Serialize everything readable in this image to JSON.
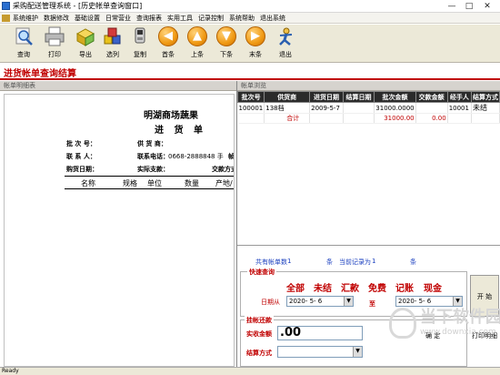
{
  "window": {
    "title": "采购配送管理系统 - [历史帐单查询窗口]",
    "minimize": "—",
    "maximize": "□",
    "close": "✕"
  },
  "menu": [
    "系统维护",
    "数据修改",
    "基础设置",
    "日常营业",
    "查询报表",
    "实用工具",
    "记录控制",
    "系统帮助",
    "退出系统"
  ],
  "toolbar": [
    {
      "label": "查询",
      "icon": "magnifier-icon"
    },
    {
      "label": "打印",
      "icon": "printer-icon"
    },
    {
      "label": "导出",
      "icon": "export-icon"
    },
    {
      "label": "选列",
      "icon": "columns-icon"
    },
    {
      "label": "复制",
      "icon": "copy-icon"
    },
    {
      "label": "首条",
      "icon": "first-record-icon"
    },
    {
      "label": "上条",
      "icon": "previous-record-icon"
    },
    {
      "label": "下条",
      "icon": "next-record-icon"
    },
    {
      "label": "末条",
      "icon": "last-record-icon"
    },
    {
      "label": "退出",
      "icon": "exit-icon"
    }
  ],
  "report_title": "进货帐单查询结算",
  "left_panel": {
    "header": "帐单明细表",
    "doc": {
      "store": "明湖商场蔬果",
      "subtitle": "进 货 单",
      "batch_label": "批 次 号：",
      "supplier_label": "供 货 商：",
      "contact_label": "联 系 人：",
      "phone_label": "联系电话：",
      "phone_value": "0668-2888848 手",
      "phone_tail": "帧",
      "date_label": "购货日期：",
      "paid_label": "实际支款：",
      "mode_label": "交款方式",
      "columns": [
        "名称",
        "规格",
        "单位",
        "数量",
        "产地/"
      ]
    }
  },
  "right_panel": {
    "header": "帐单浏览",
    "columns": [
      "批次号",
      "供货商",
      "进货日期",
      "结算日期",
      "批次金额",
      "交款金额",
      "经手人",
      "结算方式"
    ],
    "rows": [
      [
        "100001",
        "138档",
        "2009-5-7",
        "",
        "31000.0000",
        "",
        "10001",
        "未结"
      ]
    ],
    "total_row": [
      "",
      "合计",
      "",
      "",
      "31000.00",
      "0.00",
      "",
      ""
    ],
    "count_label": "共有帐单数",
    "count_value": "1",
    "count_unit": "条",
    "current_label": "当前记录为",
    "current_value": "1",
    "current_unit": "条"
  },
  "quick_search": {
    "legend": "快速查询",
    "buttons": [
      "全部",
      "未结",
      "汇款",
      "免费",
      "记账",
      "现金"
    ],
    "date_from_label": "日期从",
    "date_from": "2020- 5- 6",
    "to_label": "至",
    "date_to": "2020- 5- 6",
    "start": "开 始"
  },
  "settle": {
    "legend": "挂帐还款",
    "amount_label": "实收金额",
    "amount_value": ".00",
    "method_label": "结算方式",
    "method_value": "",
    "confirm": "确  定",
    "print": "打印明细"
  },
  "status": "Ready",
  "watermark": {
    "cn": "当下软件园",
    "en": "www.downxia.com"
  }
}
